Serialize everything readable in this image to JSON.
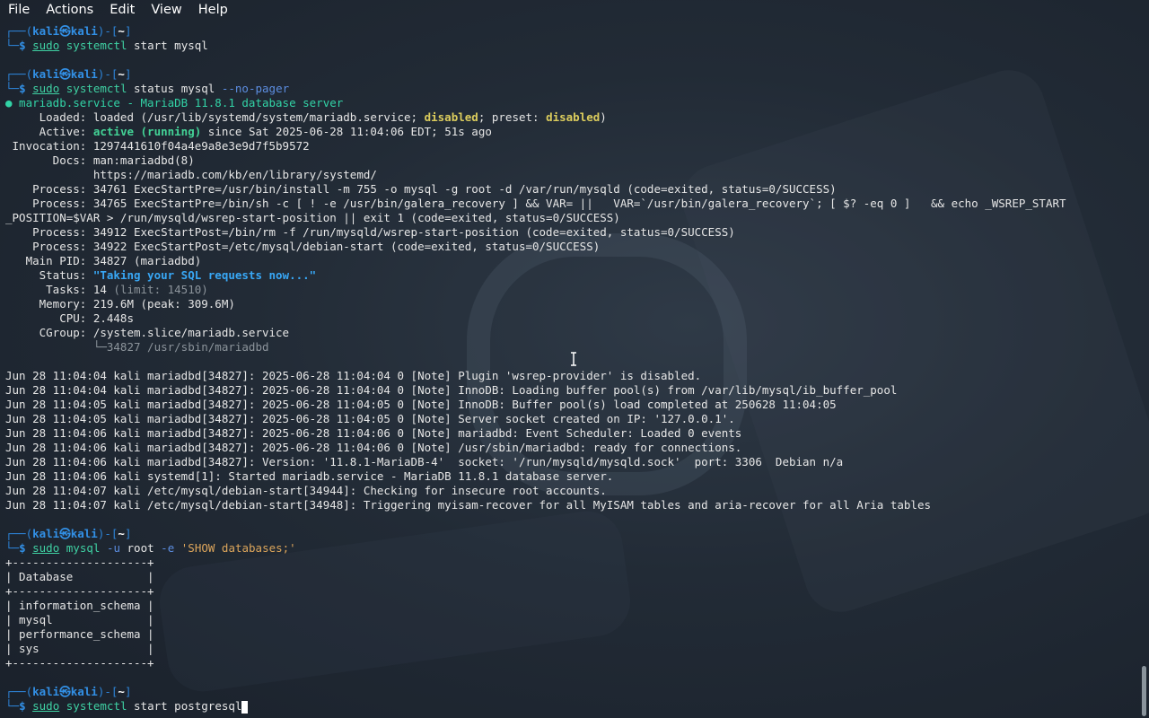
{
  "menu": [
    "File",
    "Actions",
    "Edit",
    "View",
    "Help"
  ],
  "prompt": {
    "user": "kali",
    "host": "kali",
    "dir": "~"
  },
  "cmd1": {
    "sudo": "sudo",
    "prog": "systemctl",
    "rest": " start mysql"
  },
  "cmd2": {
    "sudo": "sudo",
    "prog": "systemctl",
    "rest": " status mysql ",
    "opt": "--no-pager"
  },
  "status": {
    "header": "● mariadb.service - MariaDB 11.8.1 database server",
    "loaded_pre": "     Loaded: loaded (/usr/lib/systemd/system/mariadb.service; ",
    "loaded_disabled1": "disabled",
    "loaded_mid": "; preset: ",
    "loaded_disabled2": "disabled",
    "loaded_end": ")",
    "active_pre": "     Active: ",
    "active_state": "active (running)",
    "active_rest": " since Sat 2025-06-28 11:04:06 EDT; 51s ago",
    "invocation": " Invocation: 1297441610f04a4e9a8e3e9d7f5b9572",
    "docs1": "       Docs: man:mariadbd(8)",
    "docs2": "             https://mariadb.com/kb/en/library/systemd/",
    "proc1": "    Process: 34761 ExecStartPre=/usr/bin/install -m 755 -o mysql -g root -d /var/run/mysqld (code=exited, status=0/SUCCESS)",
    "proc2a": "    Process: 34765 ExecStartPre=/bin/sh -c [ ! -e /usr/bin/galera_recovery ] && VAR= ||   VAR=`/usr/bin/galera_recovery`; [ $? -eq 0 ]   && echo _WSREP_START",
    "proc2b": "_POSITION=$VAR > /run/mysqld/wsrep-start-position || exit 1 (code=exited, status=0/SUCCESS)",
    "proc3": "    Process: 34912 ExecStartPost=/bin/rm -f /run/mysqld/wsrep-start-position (code=exited, status=0/SUCCESS)",
    "proc4": "    Process: 34922 ExecStartPost=/etc/mysql/debian-start (code=exited, status=0/SUCCESS)",
    "mainpid": "   Main PID: 34827 (mariadbd)",
    "status_pre": "     Status: ",
    "status_val": "\"Taking your SQL requests now...\"",
    "tasks_pre": "      Tasks: 14 ",
    "tasks_limit": "(limit: 14510)",
    "memory": "     Memory: 219.6M (peak: 309.6M)",
    "cpu": "        CPU: 2.448s",
    "cgroup": "     CGroup: /system.slice/mariadb.service",
    "cgroup_child": "             └─34827 /usr/sbin/mariadbd"
  },
  "log": [
    "Jun 28 11:04:04 kali mariadbd[34827]: 2025-06-28 11:04:04 0 [Note] Plugin 'wsrep-provider' is disabled.",
    "Jun 28 11:04:04 kali mariadbd[34827]: 2025-06-28 11:04:04 0 [Note] InnoDB: Loading buffer pool(s) from /var/lib/mysql/ib_buffer_pool",
    "Jun 28 11:04:05 kali mariadbd[34827]: 2025-06-28 11:04:05 0 [Note] InnoDB: Buffer pool(s) load completed at 250628 11:04:05",
    "Jun 28 11:04:05 kali mariadbd[34827]: 2025-06-28 11:04:05 0 [Note] Server socket created on IP: '127.0.0.1'.",
    "Jun 28 11:04:06 kali mariadbd[34827]: 2025-06-28 11:04:06 0 [Note] mariadbd: Event Scheduler: Loaded 0 events",
    "Jun 28 11:04:06 kali mariadbd[34827]: 2025-06-28 11:04:06 0 [Note] /usr/sbin/mariadbd: ready for connections.",
    "Jun 28 11:04:06 kali mariadbd[34827]: Version: '11.8.1-MariaDB-4'  socket: '/run/mysqld/mysqld.sock'  port: 3306  Debian n/a",
    "Jun 28 11:04:06 kali systemd[1]: Started mariadb.service - MariaDB 11.8.1 database server.",
    "Jun 28 11:04:07 kali /etc/mysql/debian-start[34944]: Checking for insecure root accounts.",
    "Jun 28 11:04:07 kali /etc/mysql/debian-start[34948]: Triggering myisam-recover for all MyISAM tables and aria-recover for all Aria tables"
  ],
  "cmd3": {
    "sudo": "sudo",
    "prog": "mysql",
    "opt1": "-u",
    "user": "root",
    "opt2": "-e",
    "str": "'SHOW databases;'"
  },
  "table": {
    "border": "+--------------------+",
    "header": "| Database           |",
    "rows": [
      "| information_schema |",
      "| mysql              |",
      "| performance_schema |",
      "| sys                |"
    ]
  },
  "cmd4": {
    "sudo": "sudo",
    "prog": "systemctl",
    "rest": " start postgresql"
  }
}
